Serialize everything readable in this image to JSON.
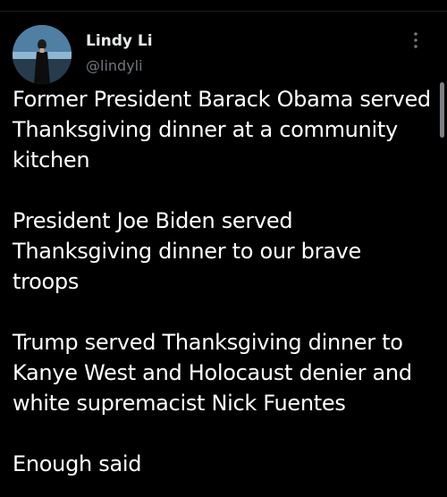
{
  "author": {
    "display_name": "Lindy Li",
    "handle": "@lindyli"
  },
  "icons": {
    "avatar": "profile-photo",
    "more": "more-vertical-icon"
  },
  "tweet": {
    "paragraphs": [
      "Former President Barack Obama served Thanksgiving dinner at a community kitchen",
      "President Joe Biden served Thanksgiving dinner to our brave troops",
      "Trump served Thanksgiving dinner to Kanye West and Holocaust denier and white supremacist Nick Fuentes",
      "Enough said"
    ]
  },
  "colors": {
    "background": "#000000",
    "text_primary": "#e7e9ea",
    "text_secondary": "#71767b"
  }
}
